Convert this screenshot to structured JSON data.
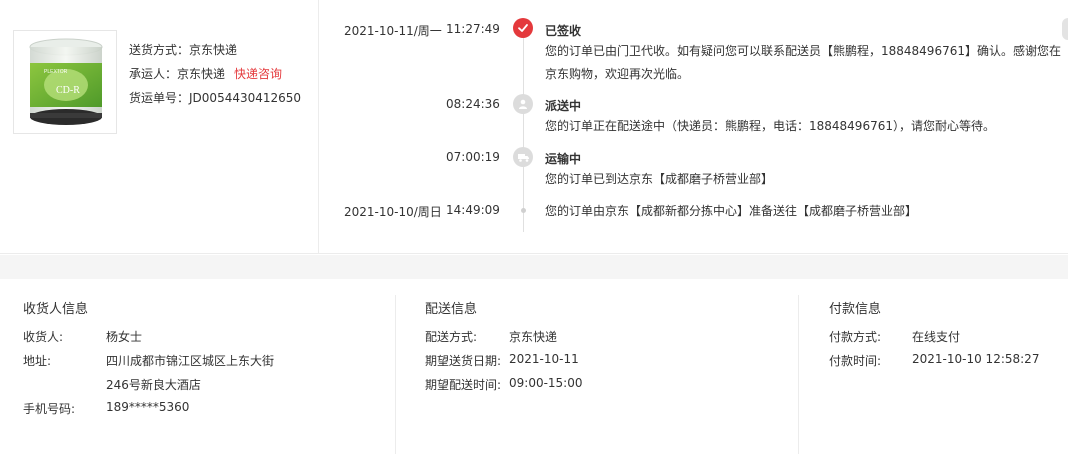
{
  "shipping": {
    "method_label": "送货方式：",
    "method_value": "京东快递",
    "carrier_label": "承运人：",
    "carrier_value": "京东快递",
    "consult_link": "快递咨询",
    "tracking_label": "货运单号：",
    "tracking_value": "JD0054430412650"
  },
  "product": {
    "image_icon": "cd-r-spindle-image",
    "brand": "PLEXTOR",
    "label": "CD-R"
  },
  "timeline": [
    {
      "date": "2021-10-11/周一",
      "time": "11:27:49",
      "icon": "check-icon",
      "status": "已签收",
      "desc": "您的订单已由门卫代收。如有疑问您可以联系配送员【熊鹏程，18848496761】确认。感谢您在京东购物，欢迎再次光临。"
    },
    {
      "date": "",
      "time": "08:24:36",
      "icon": "courier-icon",
      "status": "派送中",
      "desc": "您的订单正在配送途中（快递员：熊鹏程，电话：18848496761），请您耐心等待。"
    },
    {
      "date": "",
      "time": "07:00:19",
      "icon": "truck-icon",
      "status": "运输中",
      "desc": "您的订单已到达京东【成都磨子桥营业部】"
    },
    {
      "date": "2021-10-10/周日",
      "time": "14:49:09",
      "icon": "dot",
      "status": "",
      "desc": "您的订单由京东【成都新都分拣中心】准备送往【成都磨子桥营业部】"
    }
  ],
  "receiver": {
    "title": "收货人信息",
    "name_label": "收货人:",
    "name_value": "杨女士",
    "address_label": "地址:",
    "address_line1": "四川成都市锦江区城区上东大街",
    "address_line2": "246号新良大酒店",
    "phone_label": "手机号码:",
    "phone_value": "189*****5360"
  },
  "delivery": {
    "title": "配送信息",
    "method_label": "配送方式:",
    "method_value": "京东快递",
    "date_label": "期望送货日期:",
    "date_value": "2021-10-11",
    "time_label": "期望配送时间:",
    "time_value": "09:00-15:00"
  },
  "payment": {
    "title": "付款信息",
    "method_label": "付款方式:",
    "method_value": "在线支付",
    "time_label": "付款时间:",
    "time_value": "2021-10-10 12:58:27"
  },
  "colors": {
    "accent": "#e4393c",
    "text": "#333333",
    "border": "#ececec",
    "band": "#f5f5f5"
  }
}
